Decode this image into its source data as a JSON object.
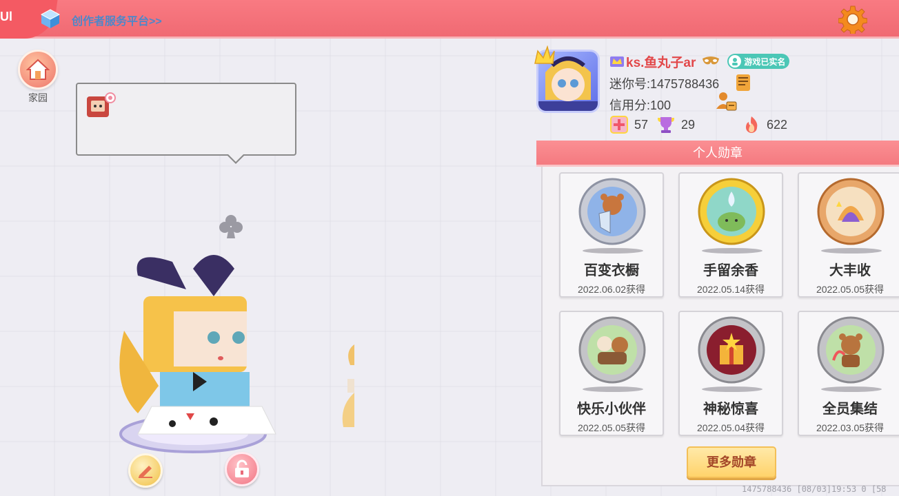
{
  "topbar": {
    "corner_text": "Ul",
    "creator_link": "创作者服务平台>>"
  },
  "home": {
    "label": "家园"
  },
  "profile": {
    "username": "ks.鱼丸子ar",
    "verified": "游戏已实名",
    "mini_id": "迷你号:1475788436",
    "credit": "信用分:100",
    "stats": [
      {
        "icon": "plus-card-icon",
        "value": "57"
      },
      {
        "icon": "trophy-icon",
        "value": "29"
      },
      {
        "icon": "flame-icon",
        "value": "622"
      }
    ]
  },
  "medals": {
    "header": "个人勋章",
    "items": [
      {
        "name": "百变衣橱",
        "date": "2022.06.02获得",
        "tier": "silver"
      },
      {
        "name": "手留余香",
        "date": "2022.05.14获得",
        "tier": "gold"
      },
      {
        "name": "大丰收",
        "date": "2022.05.05获得",
        "tier": "bronze"
      },
      {
        "name": "快乐小伙伴",
        "date": "2022.05.05获得",
        "tier": "silver"
      },
      {
        "name": "神秘惊喜",
        "date": "2022.05.04获得",
        "tier": "dark"
      },
      {
        "name": "全员集结",
        "date": "2022.03.05获得",
        "tier": "silver"
      }
    ],
    "more_button": "更多勋章"
  },
  "footer": {
    "text": "1475788436   [08/03]19:53 0  [58"
  },
  "colors": {
    "topbar": "#f06a73",
    "username": "#e2484a",
    "verified": "#4bc7b6",
    "more_button": "#ffd36b"
  }
}
